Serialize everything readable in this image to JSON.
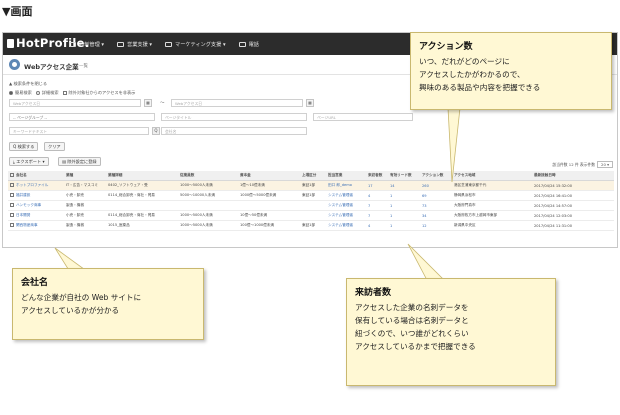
{
  "heading": "▼画面",
  "app": {
    "logo": "HotProfile.",
    "nav": [
      {
        "label": "名刺管理 ▾",
        "icon": "card-icon"
      },
      {
        "label": "営業支援 ▾",
        "icon": "briefcase-icon"
      },
      {
        "label": "マーケティング支援 ▾",
        "icon": "chart-icon"
      },
      {
        "label": "電話",
        "icon": "phone-icon"
      }
    ],
    "title": "Webアクセス企業",
    "title_sub": "一覧",
    "filter_note": "▲ 検索条件を閉じる",
    "search_modes": [
      {
        "label": "簡易検索",
        "selected": true
      },
      {
        "label": "詳細検索",
        "selected": false
      }
    ],
    "exclude_label": "除外対象社からのアクセスを非表示",
    "fields": {
      "date_from": "Webアクセス日",
      "date_to": "Webアクセス日",
      "page_group": "-- ページグループ --",
      "page_title": "ページタイトル",
      "page_url": "ページURL",
      "keyword": "キーワードテキスト",
      "company": "会社名"
    },
    "buttons": {
      "search": "Q 検索する",
      "clear": "クリア",
      "export": "エクスポート ▾",
      "exclude": "除外設定に登録"
    },
    "count_text": "該当件数 12 件  表示件数",
    "page_size": "20",
    "table": {
      "headers": [
        "会社名",
        "業種",
        "業種詳細",
        "従業員数",
        "資本金",
        "上場区分",
        "担当営業",
        "来訪者数",
        "有効リード数",
        "アクション数",
        "アクセス地域",
        "最新接触日時"
      ],
      "rows": [
        [
          "ホットプロファイル",
          "IT・広告・マスコミ",
          "0402_ソフトウェア・受",
          "1000～5000人未満",
          "1億～10億未満",
          "東証1部",
          "田口 郎_demo",
          "17",
          "14",
          "260",
          "港区芝浦東京都千代",
          "2017/04/24 15:32:00"
        ],
        [
          "福井建設",
          "小売・卸売",
          "0114_総合卸売・商社・貿易",
          "5000～10000人未満",
          "1000億～5000億未満",
          "東証1部",
          "システム管理者",
          "4",
          "1",
          "69",
          "静岡県浜松市",
          "2017/04/24 16:41:00"
        ],
        [
          "ハンモック商事",
          "製造・機械",
          "",
          "",
          "",
          "",
          "システム管理者",
          "7",
          "1",
          "73",
          "大阪府門真市",
          "2017/04/24 14:57:00"
        ],
        [
          "日本開発",
          "小売・卸売",
          "0114_総合卸売・商社・貿易",
          "1000～5000人未満",
          "10億～50億未満",
          "",
          "システム管理者",
          "7",
          "1",
          "34",
          "大阪府枚方市上越岡市東部",
          "2017/04/24 12:03:00"
        ],
        [
          "関西物産商事",
          "製造・機械",
          "1015_医薬品",
          "1000～5000人未満",
          "100億～1000億未満",
          "東証1部",
          "システム管理者",
          "4",
          "1",
          "12",
          "新潟県中央区",
          "2017/04/24 11:31:00"
        ]
      ]
    }
  },
  "callouts": {
    "action": {
      "title": "アクション数",
      "lines": [
        "いつ、だれがどのページに",
        "アクセスしたかがわかるので、",
        "興味のある製品や内容を把握できる"
      ]
    },
    "company": {
      "title": "会社名",
      "lines": [
        "どんな企業が自社の Web サイトに",
        "アクセスしているかが分かる"
      ]
    },
    "visitors": {
      "title": "来訪者数",
      "lines": [
        "アクセスした企業の名刺データを",
        "保有している場合は名刺データと",
        "紐づくので、いつ誰がどれくらい",
        "アクセスしているかまで把握できる"
      ]
    }
  },
  "colors": {
    "accent": "#3b6fb6",
    "callout_bg": "#fff8d4",
    "header_bg": "#2c2c2c"
  }
}
